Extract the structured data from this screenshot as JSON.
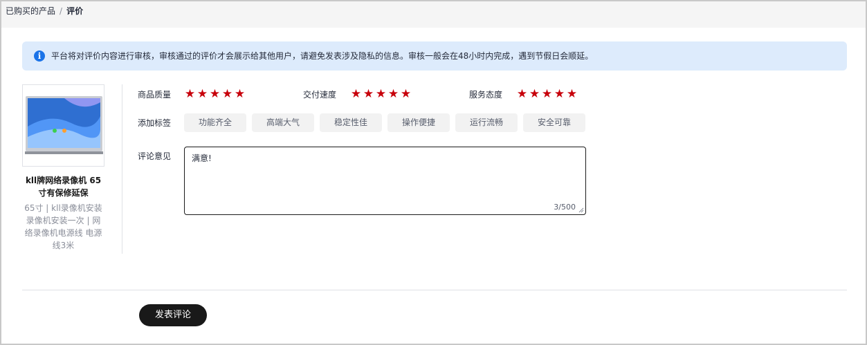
{
  "breadcrumb": {
    "parent": "已购买的产品",
    "separator": "/",
    "current": "评价"
  },
  "notice": {
    "icon": "info-icon",
    "icon_glyph": "i",
    "text": "平台将对评价内容进行审核，审核通过的评价才会展示给其他用户，请避免发表涉及隐私的信息。审核一般会在48小时内完成，遇到节假日会顺延。"
  },
  "product": {
    "name": "kll牌网络录像机 65寸有保修延保",
    "spec": "65寸 | kll录像机安装录像机安装一次 | 网络录像机电源线 电源线3米"
  },
  "ratings": [
    {
      "label": "商品质量",
      "stars": 5,
      "max": 5
    },
    {
      "label": "交付速度",
      "stars": 5,
      "max": 5
    },
    {
      "label": "服务态度",
      "stars": 5,
      "max": 5
    }
  ],
  "tags": {
    "label": "添加标签",
    "items": [
      "功能齐全",
      "高端大气",
      "稳定性佳",
      "操作便捷",
      "运行流畅",
      "安全可靠"
    ]
  },
  "comment": {
    "label": "评论意见",
    "value": "满意!",
    "counter": "3/500"
  },
  "submit_label": "发表评论",
  "colors": {
    "accent": "#c7000b",
    "info": "#1a73e8",
    "notice_bg": "#ddebfc",
    "button_bg": "#191919"
  }
}
